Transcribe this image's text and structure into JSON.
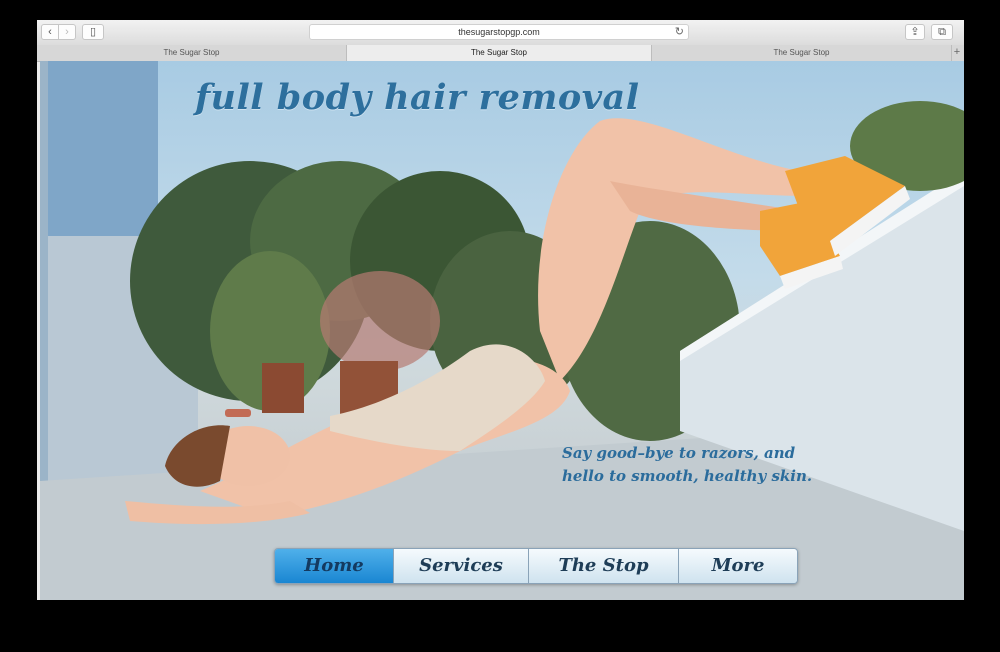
{
  "browser": {
    "url": "thesugarstopgp.com",
    "back_glyph": "‹",
    "forward_glyph": "›",
    "sidebar_glyph": "▯",
    "reload_glyph": "↻",
    "share_glyph": "⇪",
    "tabs_glyph": "⧉",
    "new_tab_glyph": "+",
    "tabs": [
      {
        "title": "The Sugar Stop"
      },
      {
        "title": "The Sugar Stop"
      },
      {
        "title": "The Sugar Stop"
      }
    ],
    "active_tab_index": 1
  },
  "hero": {
    "headline": "full body hair removal",
    "tagline_line1": "Say good–bye to razors, and",
    "tagline_line2": "hello to smooth, healthy skin."
  },
  "nav": {
    "items": [
      {
        "label": "Home"
      },
      {
        "label": "Services"
      },
      {
        "label": "The Stop"
      },
      {
        "label": "More"
      }
    ],
    "active_index": 0
  },
  "colors": {
    "headline": "#2d6f9d",
    "nav_active": "#1a86d2",
    "nav_text": "#1e3d57"
  }
}
